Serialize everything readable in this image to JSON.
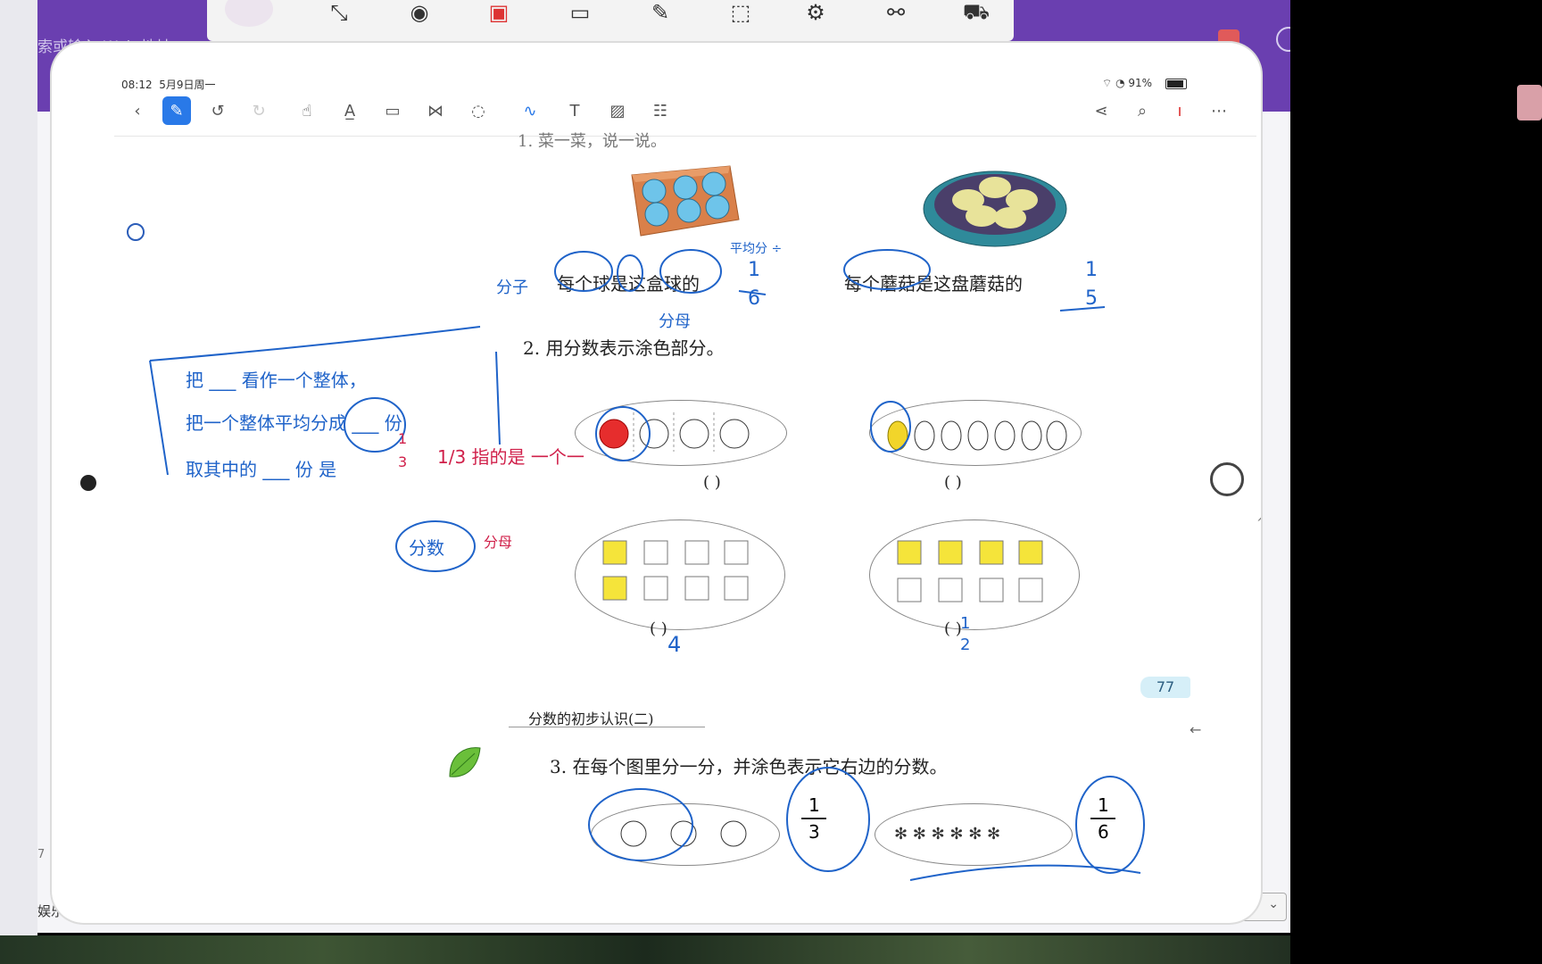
{
  "browser": {
    "address_placeholder": "索或输入 Web 地址",
    "taskbar_text": "娱乐",
    "left_number": "7"
  },
  "recorder_toolbar": {
    "buttons": [
      "collapse-icon",
      "camera-icon",
      "record-icon",
      "screen-share-icon",
      "pen-icon",
      "region-capture-icon",
      "settings-icon",
      "connection-icon",
      "cart-icon"
    ]
  },
  "status_bar": {
    "time": "08:12",
    "date": "5月9日周一",
    "battery": "91%"
  },
  "app_toolbar": {
    "tools": [
      "back",
      "pen",
      "undo",
      "redo",
      "hand",
      "text-highlight",
      "rectangle",
      "shapes",
      "lasso",
      "brush",
      "textbox",
      "image",
      "table"
    ],
    "right_tools": [
      "share",
      "search",
      "more"
    ],
    "more_label": "⋯"
  },
  "page": {
    "top_cut_text": "1. 菜一菜，说一说。",
    "q1_left": "每个球是这盒球的",
    "q1_left_answer_num": "1",
    "q1_left_answer_den": "6",
    "q1_right": "每个蘑菇是这盘蘑菇的",
    "q1_right_answer_num": "1",
    "q1_right_answer_den": "5",
    "q2_title": "2. 用分数表示涂色部分。",
    "q2_answers": [
      "(    )",
      "(    )",
      "(  )",
      "(  )"
    ],
    "q2_answer_bottom_left": "4",
    "q2_answer_bottom_right_num": "1",
    "q2_answer_bottom_right_den": "2",
    "page_number": "77",
    "chapter_title": "分数的初步认识(二)",
    "q3_title": "3. 在每个图里分一分，并涂色表示它右边的分数。",
    "q3_frac1_num": "1",
    "q3_frac1_den": "3",
    "q3_frac2_num": "1",
    "q3_frac2_den": "6"
  },
  "annotations": {
    "note_line1": "把  ___  看作一个整体，",
    "note_line2": "把一个整体平均分成 ___ 份",
    "note_line3": "取其中的 ___ 份 是",
    "note_frac_num": "1",
    "note_frac_den": "3",
    "note_red": "1/3 指的是 一个一",
    "note_fenshu": "分数",
    "note_fenmu": "分母",
    "q1_hand_left": "分子",
    "q1_hand_bottom": "分母",
    "q1_hand_top": "平均分 ÷"
  },
  "colors": {
    "accent": "#2979e8",
    "ink_blue": "#1f63c9",
    "ink_red": "#d0204a",
    "browser_purple": "#6a3fb0"
  }
}
